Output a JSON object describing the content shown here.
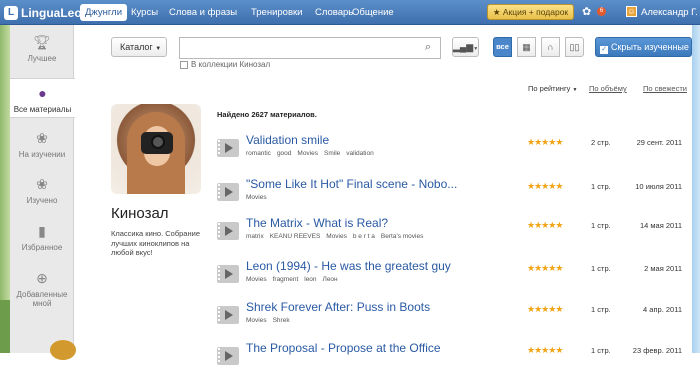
{
  "topbar": {
    "logo": "LinguaLeo",
    "nav": [
      "Джунгли",
      "Курсы",
      "Слова и фразы",
      "Тренировки",
      "Словарь",
      "Общение"
    ],
    "promo": "★ Акция + подарок",
    "notification_count": "6",
    "user_name": "Александр Г."
  },
  "sidebar": {
    "items": [
      {
        "label": "Лучшее",
        "icon": "trophy-icon"
      },
      {
        "label": "Все материалы",
        "icon": "globe-icon"
      },
      {
        "label": "На изучении",
        "icon": "paw-icon"
      },
      {
        "label": "Изучено",
        "icon": "paw-icon"
      },
      {
        "label": "Избранное",
        "icon": "bookmark-icon"
      },
      {
        "label": "Добавленные мной",
        "icon": "plus-circle-icon"
      }
    ]
  },
  "toolbar": {
    "catalog_label": "Каталог",
    "search_value": "",
    "kinozal_checkbox_label": "В коллекции Кинозал",
    "hide_learned_label": "Скрыть изученные",
    "filter_all_label": "все"
  },
  "sort": {
    "rating": "По рейтингу",
    "size": "По объёму",
    "new": "По свежести"
  },
  "collection": {
    "title": "Кинозал",
    "description": "Классика кино. Собрание лучших киноклипов на любой вкус!"
  },
  "results": {
    "found_text": "Найдено 2627 материалов.",
    "items": [
      {
        "title": "Validation smile",
        "tags": [
          "romantic",
          "good",
          "Movies",
          "Smile",
          "validation"
        ],
        "rating": 5,
        "pages": "2 стр.",
        "date": "29 сент. 2011"
      },
      {
        "title": "\"Some Like It Hot\" Final scene - Nobo...",
        "tags": [
          "Movies"
        ],
        "rating": 5,
        "pages": "1 стр.",
        "date": "10 июля 2011"
      },
      {
        "title": "The Matrix - What is Real?",
        "tags": [
          "matrix",
          "KEANU REEVES",
          "Movies",
          "b e r t a",
          "Berta's movies"
        ],
        "rating": 5,
        "pages": "1 стр.",
        "date": "14 мая 2011"
      },
      {
        "title": "Leon (1994) - He was the greatest guy",
        "tags": [
          "Movies",
          "fragment",
          "leon",
          "Леон"
        ],
        "rating": 5,
        "pages": "1 стр.",
        "date": "2 мая 2011"
      },
      {
        "title": "Shrek Forever After: Puss in Boots",
        "tags": [
          "Movies",
          "Shrek"
        ],
        "rating": 5,
        "pages": "1 стр.",
        "date": "4 апр. 2011"
      },
      {
        "title": "The Proposal - Propose at the Office",
        "tags": [],
        "rating": 5,
        "pages": "1 стр.",
        "date": "23 февр. 2011"
      }
    ]
  },
  "colors": {
    "topbar": "#4a7fbf",
    "link": "#2a5aa3",
    "star": "#f1a414",
    "accent": "#4a86c9"
  }
}
